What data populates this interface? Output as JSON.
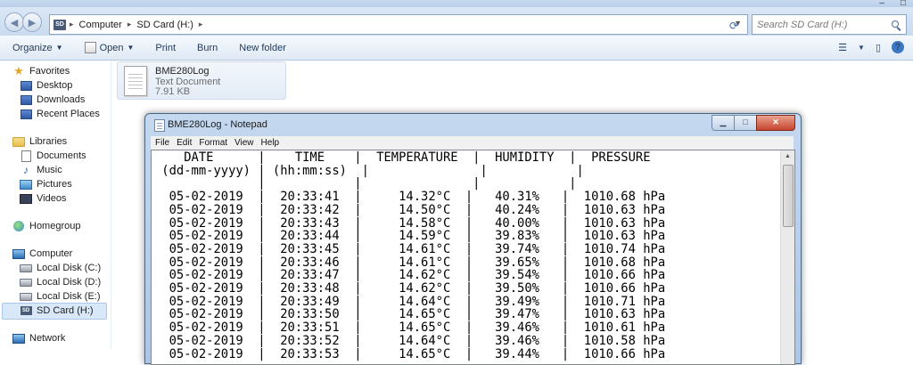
{
  "explorer": {
    "address": {
      "crumbs": [
        "Computer",
        "SD Card (H:)"
      ]
    },
    "search": {
      "placeholder": "Search SD Card (H:)"
    },
    "toolbar": {
      "organize": "Organize",
      "open": "Open",
      "print": "Print",
      "burn": "Burn",
      "new_folder": "New folder"
    },
    "sidebar": {
      "favorites": {
        "label": "Favorites",
        "items": [
          "Desktop",
          "Downloads",
          "Recent Places"
        ]
      },
      "libraries": {
        "label": "Libraries",
        "items": [
          "Documents",
          "Music",
          "Pictures",
          "Videos"
        ]
      },
      "homegroup": "Homegroup",
      "computer": {
        "label": "Computer",
        "items": [
          "Local Disk (C:)",
          "Local Disk (D:)",
          "Local Disk (E:)",
          "SD Card (H:)"
        ]
      },
      "network": "Network",
      "selected": "SD Card (H:)"
    },
    "file": {
      "name": "BME280Log",
      "type": "Text Document",
      "size": "7.91 KB"
    }
  },
  "notepad": {
    "title": "BME280Log - Notepad",
    "menu": [
      "File",
      "Edit",
      "Format",
      "View",
      "Help"
    ],
    "header1": "    DATE      |    TIME    |  TEMPERATURE  |  HUMIDITY  |  PRESSURE",
    "header2": " (dd-mm-yyyy) | (hh:mm:ss)  |               |            |",
    "spacer": "              |            |               |            |",
    "row_format": {
      "pre": "  ",
      "date_sep": "  |  ",
      "time_sep": "  |     ",
      "temp_sep": "  |   ",
      "hum_sep": "   |  "
    },
    "rows": [
      [
        "05-02-2019",
        "20:33:41",
        "14.32°C",
        "40.31%",
        "1010.68 hPa"
      ],
      [
        "05-02-2019",
        "20:33:42",
        "14.50°C",
        "40.24%",
        "1010.63 hPa"
      ],
      [
        "05-02-2019",
        "20:33:43",
        "14.58°C",
        "40.00%",
        "1010.63 hPa"
      ],
      [
        "05-02-2019",
        "20:33:44",
        "14.59°C",
        "39.83%",
        "1010.63 hPa"
      ],
      [
        "05-02-2019",
        "20:33:45",
        "14.61°C",
        "39.74%",
        "1010.74 hPa"
      ],
      [
        "05-02-2019",
        "20:33:46",
        "14.61°C",
        "39.65%",
        "1010.68 hPa"
      ],
      [
        "05-02-2019",
        "20:33:47",
        "14.62°C",
        "39.54%",
        "1010.66 hPa"
      ],
      [
        "05-02-2019",
        "20:33:48",
        "14.62°C",
        "39.50%",
        "1010.66 hPa"
      ],
      [
        "05-02-2019",
        "20:33:49",
        "14.64°C",
        "39.49%",
        "1010.71 hPa"
      ],
      [
        "05-02-2019",
        "20:33:50",
        "14.65°C",
        "39.47%",
        "1010.63 hPa"
      ],
      [
        "05-02-2019",
        "20:33:51",
        "14.65°C",
        "39.46%",
        "1010.61 hPa"
      ],
      [
        "05-02-2019",
        "20:33:52",
        "14.64°C",
        "39.46%",
        "1010.58 hPa"
      ],
      [
        "05-02-2019",
        "20:33:53",
        "14.65°C",
        "39.44%",
        "1010.66 hPa"
      ]
    ]
  }
}
